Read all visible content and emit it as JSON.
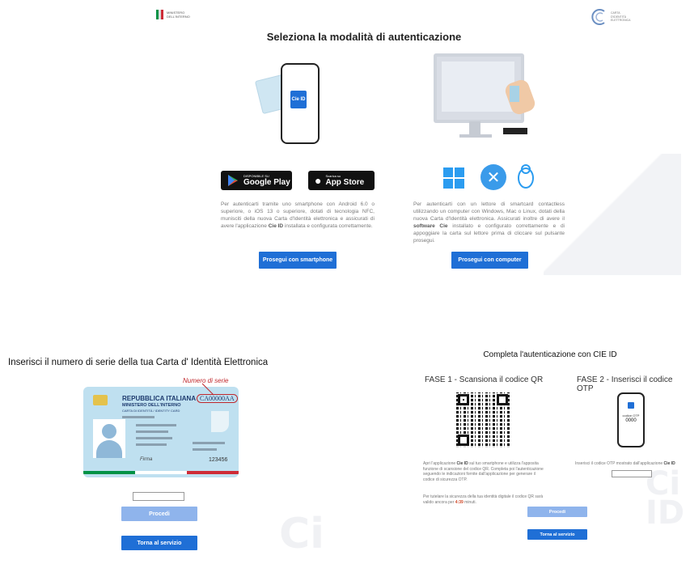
{
  "top": {
    "ministry_text_1": "MINISTERO",
    "ministry_text_2": "DELL'INTERNO",
    "title": "Seleziona la modalità di autenticazione",
    "brand_text_1": "CARTA",
    "brand_text_2": "D'IDENTITÀ",
    "brand_text_3": "ELETTRONICA",
    "smartphone": {
      "cie_logo": "Cie ID",
      "google_small": "DISPONIBILE SU",
      "google_big": "Google Play",
      "apple_small": "Scarica su",
      "apple_big": "App Store",
      "desc_1": "Per autenticarti tramite uno smartphone con Android 6.0 o superiore, o iOS 13 o superiore, dotati di tecnologia NFC, munisciti della nuova Carta d'Identità elettronica e assicurati di avere l'applicazione ",
      "desc_bold": "Cie ID",
      "desc_2": " installata e configurata correttamente.",
      "button": "Prosegui con smartphone"
    },
    "computer": {
      "desc_1": "Per autenticarti con un lettore di smartcard contactless utilizzando un computer con Windows, Mac o Linux, dotati della nuova Carta d'Identità elettronica. Assicurati inoltre di avere il ",
      "desc_bold": "software Cie",
      "desc_2": " installato e configurato correttamente e di appoggiare la carta sul lettore prima di cliccare sul pulsante prosegui.",
      "button": "Prosegui con computer"
    }
  },
  "bottom_left": {
    "title": "Inserisci il numero di serie della tua Carta d'  Identità Elettronica",
    "serial_label": "Numero di serie",
    "card": {
      "line1": "REPUBBLICA ITALIANA",
      "line2": "MINISTERO DELL'INTERNO",
      "line3": "CARTA DI IDENTITÀ / IDENTITY CARD",
      "serial": "CA00000AA",
      "signature": "Firma",
      "number": "123456"
    },
    "input_value": "",
    "proceed_button": "Procedi",
    "back_button": "Torna al servizio"
  },
  "bottom_right": {
    "title": "Completa l'autenticazione con CIE ID",
    "phase1": "FASE 1 - Scansiona il codice QR",
    "phase2": "FASE 2 - Inserisci il codice OTP",
    "phone_label": "codice OTP",
    "phone_code": "0000",
    "qr_text_1": "Apri l'applicazione ",
    "qr_text_bold": "Cie ID",
    "qr_text_2": " sul tuo smartphone e utilizza l'apposita funzione di scansione del codice QR. Completa poi l'autenticazione seguendo le indicazioni fornite dall'applicazione per generare il codice di sicurezza OTP.",
    "otp_text_1": "Inserisci il codice OTP mostrato dall'applicazione ",
    "otp_text_bold": "Cie ID",
    "validity_1": "Per tutelare la sicurezza della tua identità digitale il codice QR sarà valido ancora per ",
    "validity_time": "4:39",
    "validity_2": " minuti.",
    "otp_value": "",
    "proceed_button": "Procedi",
    "back_button": "Torna al servizio"
  },
  "watermark": "Cie ID",
  "colors": {
    "primary": "#1f6fd6",
    "primary_light": "#8fb4ec",
    "timer": "#d04a2a",
    "serial_red": "#c0282d"
  }
}
